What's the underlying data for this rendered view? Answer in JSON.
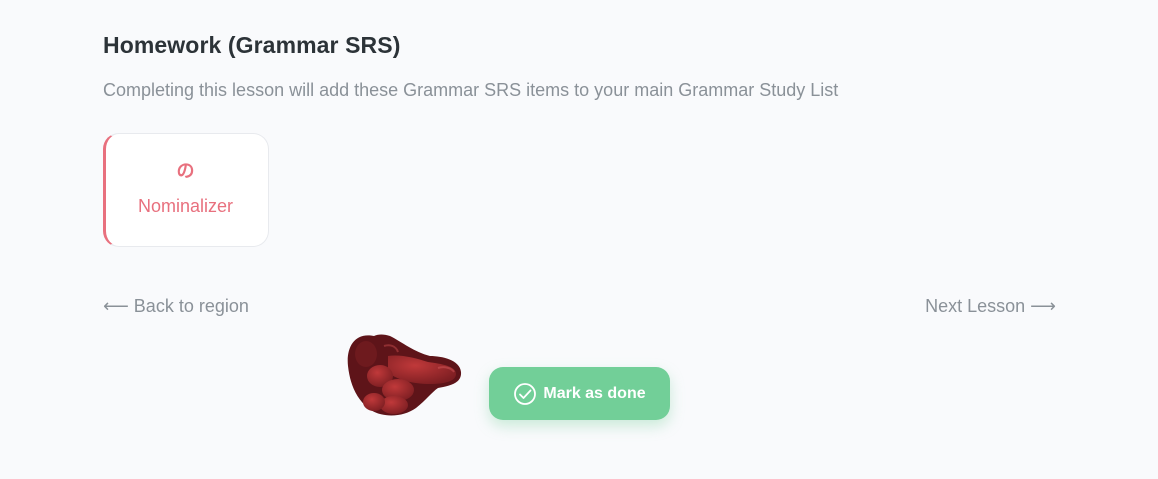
{
  "lesson_section": {
    "title": "Homework (Grammar SRS)",
    "subtitle": "Completing this lesson will add these Grammar SRS items to your main Grammar Study List"
  },
  "srs_items": [
    {
      "glyph": "の",
      "label": "Nominalizer",
      "accent_color": "#e8707e"
    }
  ],
  "navigation": {
    "back_label": "⟵ Back to region",
    "next_label": "Next Lesson ⟶"
  },
  "actions": {
    "mark_done_label": "Mark as done",
    "mark_done_icon": "check-circle-icon",
    "mark_done_color": "#72cf98"
  },
  "mascot": {
    "icon": "pointing-hand-mascot",
    "color": "#7a1f24"
  }
}
